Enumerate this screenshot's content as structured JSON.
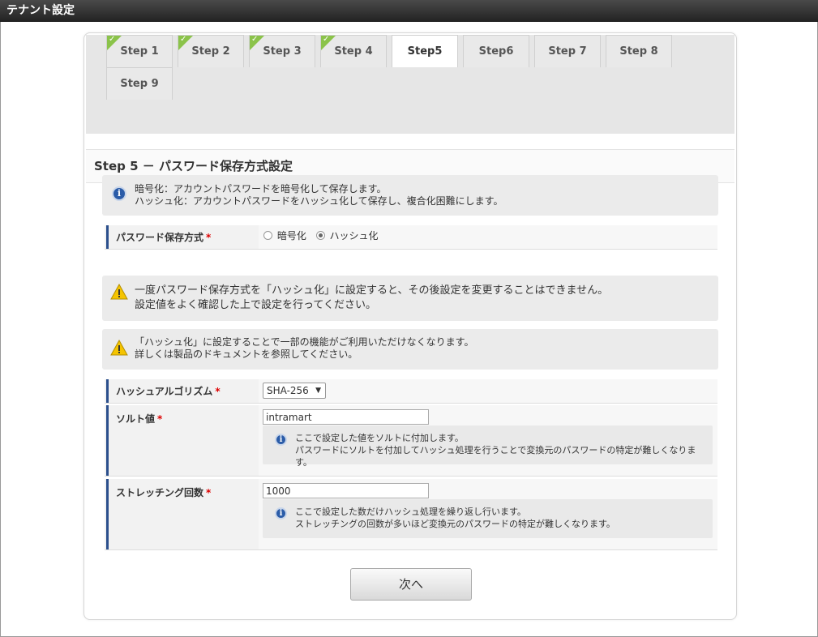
{
  "window": {
    "title": "テナント設定"
  },
  "steps": [
    {
      "label": "Step 1",
      "done": true
    },
    {
      "label": "Step 2",
      "done": true
    },
    {
      "label": "Step 3",
      "done": true
    },
    {
      "label": "Step 4",
      "done": true
    },
    {
      "label": "Step5",
      "done": false,
      "active": true
    },
    {
      "label": "Step6",
      "done": false
    },
    {
      "label": "Step 7",
      "done": false
    },
    {
      "label": "Step 8",
      "done": false
    },
    {
      "label": "Step 9",
      "done": false
    }
  ],
  "section": {
    "title": "Step 5 － パスワード保存方式設定"
  },
  "intro_info": {
    "line1": "暗号化：アカウントパスワードを暗号化して保存します。",
    "line2": "ハッシュ化：アカウントパスワードをハッシュ化して保存し、複合化困難にします。"
  },
  "storage_method": {
    "label": "パスワード保存方式",
    "required_mark": "*",
    "options": [
      "暗号化",
      "ハッシュ化"
    ],
    "selected": "ハッシュ化"
  },
  "warning1": {
    "line1": "一度パスワード保存方式を「ハッシュ化」に設定すると、その後設定を変更することはできません。",
    "line2": "設定値をよく確認した上で設定を行ってください。"
  },
  "warning2": {
    "line1": "「ハッシュ化」に設定することで一部の機能がご利用いただけなくなります。",
    "line2": "詳しくは製品のドキュメントを参照してください。"
  },
  "hash_algorithm": {
    "label": "ハッシュアルゴリズム",
    "required_mark": "*",
    "value": "SHA-256"
  },
  "salt": {
    "label": "ソルト値",
    "required_mark": "*",
    "value": "intramart",
    "info_line1": "ここで設定した値をソルトに付加します。",
    "info_line2": "パスワードにソルトを付加してハッシュ処理を行うことで変換元のパスワードの特定が難しくなります。"
  },
  "stretching": {
    "label": "ストレッチング回数",
    "required_mark": "*",
    "value": "1000",
    "info_line1": "ここで設定した数だけハッシュ処理を繰り返し行います。",
    "info_line2": "ストレッチングの回数が多いほど変換元のパスワードの特定が難しくなります。"
  },
  "next_button": {
    "label": "次へ"
  },
  "colors": {
    "check": "#8bc34a",
    "label_accent": "#2b4f8c",
    "required": "#dd0000",
    "info_icon": "#2b5ca8",
    "warn_icon": "#f5c400"
  }
}
